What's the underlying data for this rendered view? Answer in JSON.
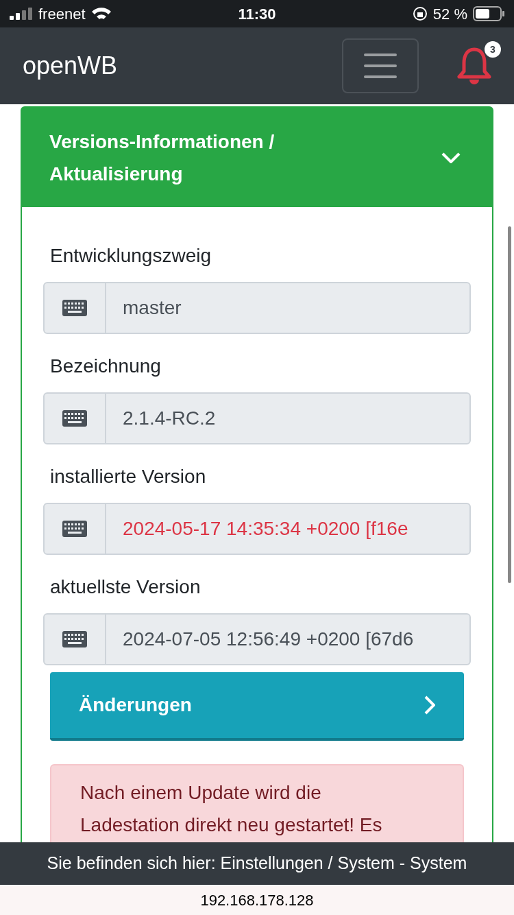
{
  "status_bar": {
    "carrier": "freenet",
    "time": "11:30",
    "battery": "52 %"
  },
  "navbar": {
    "brand": "openWB",
    "notification_count": "3"
  },
  "card": {
    "title": "Versions-Informationen / Aktualisierung",
    "expanded": true,
    "fields": [
      {
        "label": "Entwicklungszweig",
        "value": "master",
        "warning": false
      },
      {
        "label": "Bezeichnung",
        "value": "2.1.4-RC.2",
        "warning": false
      },
      {
        "label": "installierte Version",
        "value": "2024-05-17 14:35:34 +0200 [f16e",
        "warning": true
      },
      {
        "label": "aktuellste Version",
        "value": "2024-07-05 12:56:49 +0200 [67d6",
        "warning": false
      }
    ],
    "changes_button": "Änderungen",
    "alert": "Nach einem Update wird die Ladestation direkt neu gestartet! Es"
  },
  "footer": {
    "breadcrumb": "Sie befinden sich hier: Einstellungen / System - System"
  },
  "browser": {
    "url": "192.168.178.128"
  }
}
